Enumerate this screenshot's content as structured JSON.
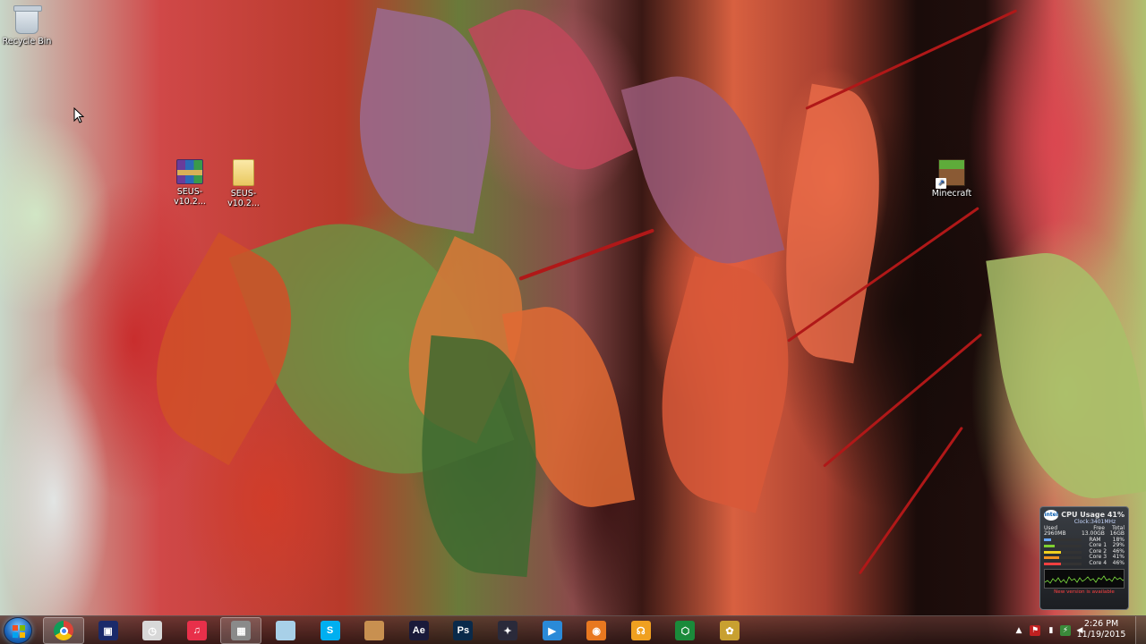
{
  "desktop": {
    "icons": [
      {
        "label": "Recycle Bin",
        "icon": "recycle-bin-icon"
      },
      {
        "label": "SEUS-v10.2...",
        "icon": "winrar-archive-icon"
      },
      {
        "label": "SEUS-v10.2...",
        "icon": "folder-icon"
      },
      {
        "label": "Minecraft",
        "icon": "minecraft-icon"
      }
    ]
  },
  "cpu_gadget": {
    "brand": "intel",
    "title": "CPU Usage",
    "usage": "41%",
    "clock": "Clock:3401MHz",
    "mem_headers": [
      "Used",
      "Free",
      "Total"
    ],
    "mem_values": [
      "2960MB",
      "13.00GB",
      "16GB"
    ],
    "rows": [
      {
        "label": "RAM",
        "value": "18%",
        "fraction": 0.18,
        "color": "#6aa8ff"
      },
      {
        "label": "Core 1",
        "value": "29%",
        "fraction": 0.29,
        "color": "#7fd030"
      },
      {
        "label": "Core 2",
        "value": "46%",
        "fraction": 0.46,
        "color": "#f0d020"
      },
      {
        "label": "Core 3",
        "value": "41%",
        "fraction": 0.41,
        "color": "#f09020"
      },
      {
        "label": "Core 4",
        "value": "46%",
        "fraction": 0.46,
        "color": "#f04040"
      }
    ],
    "new_version": "New version is available"
  },
  "taskbar": {
    "start": "start-button",
    "items": [
      {
        "name": "chrome",
        "icon": "chrome-icon",
        "glyph": "",
        "bg": "#e8e8e8",
        "active": true
      },
      {
        "name": "cmd",
        "icon": "terminal-icon",
        "glyph": "▣",
        "bg": "#1a2a6a",
        "active": false
      },
      {
        "name": "clock-app",
        "icon": "clock-icon",
        "glyph": "◷",
        "bg": "#d8d8d8",
        "active": false
      },
      {
        "name": "itunes",
        "icon": "music-icon",
        "glyph": "♫",
        "bg": "#e8304a",
        "active": false
      },
      {
        "name": "minecraft-launcher",
        "icon": "window-app-icon",
        "glyph": "▦",
        "bg": "#8a8a8a",
        "active": true
      },
      {
        "name": "notepad",
        "icon": "notepad-icon",
        "glyph": "",
        "bg": "#a8d0e8",
        "active": false
      },
      {
        "name": "skype",
        "icon": "skype-icon",
        "glyph": "S",
        "bg": "#00aff0",
        "active": false
      },
      {
        "name": "package",
        "icon": "box-icon",
        "glyph": "",
        "bg": "#c89050",
        "active": false
      },
      {
        "name": "after-effects",
        "icon": "after-effects-icon",
        "glyph": "Ae",
        "bg": "#1a1a3a",
        "active": false
      },
      {
        "name": "photoshop",
        "icon": "photoshop-icon",
        "glyph": "Ps",
        "bg": "#0a2a4a",
        "active": false
      },
      {
        "name": "video-editor",
        "icon": "film-icon",
        "glyph": "✦",
        "bg": "#2a2a3a",
        "active": false
      },
      {
        "name": "media-player",
        "icon": "play-icon",
        "glyph": "▶",
        "bg": "#2a8ad8",
        "active": false
      },
      {
        "name": "blender",
        "icon": "blender-icon",
        "glyph": "◉",
        "bg": "#e87820",
        "active": false
      },
      {
        "name": "headphones-app",
        "icon": "headphones-icon",
        "glyph": "☊",
        "bg": "#f0a020",
        "active": false
      },
      {
        "name": "green-app",
        "icon": "hexagon-icon",
        "glyph": "⬡",
        "bg": "#1a8a3a",
        "active": false
      },
      {
        "name": "pineapple-app",
        "icon": "pineapple-icon",
        "glyph": "✿",
        "bg": "#c8a030",
        "active": false
      }
    ]
  },
  "tray": {
    "time": "2:26 PM",
    "date": "11/19/2015"
  }
}
